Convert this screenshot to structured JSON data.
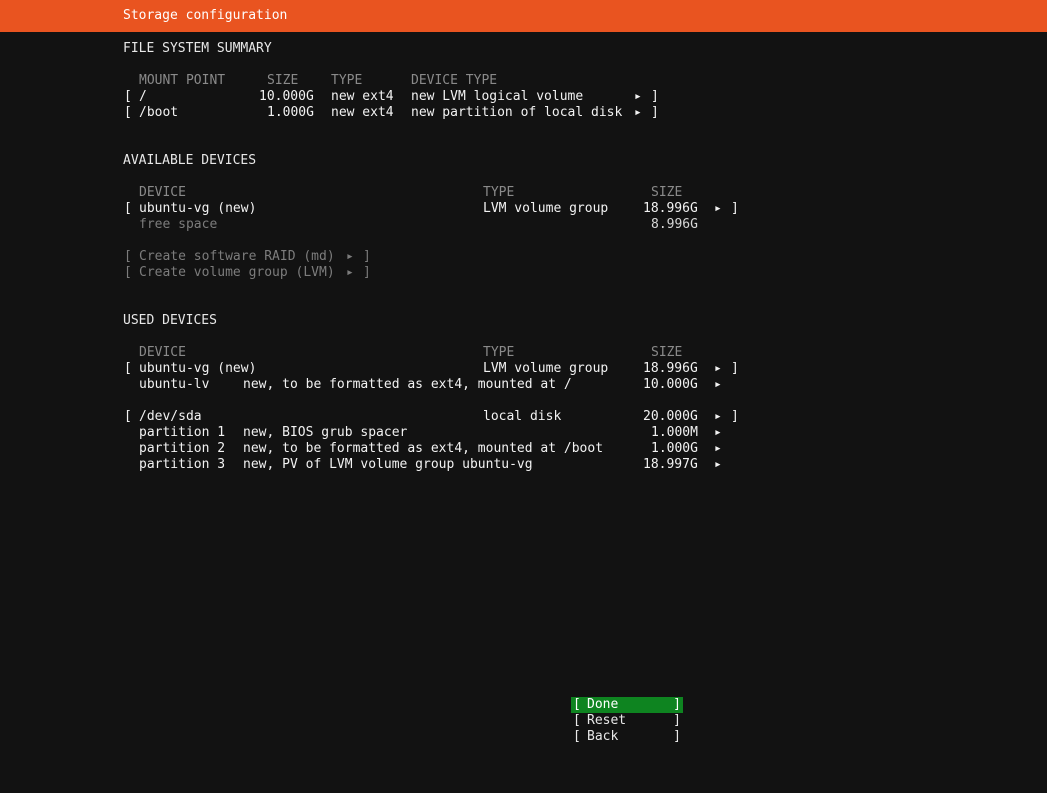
{
  "header": {
    "title": "Storage configuration"
  },
  "fs_summary": {
    "title": "FILE SYSTEM SUMMARY",
    "columns": {
      "mount": "MOUNT POINT",
      "size": "SIZE",
      "type": "TYPE",
      "device_type": "DEVICE TYPE"
    },
    "rows": [
      {
        "mount": "/",
        "size": "10.000G",
        "type": "new ext4",
        "device_type": "new LVM logical volume"
      },
      {
        "mount": "/boot",
        "size": "1.000G",
        "type": "new ext4",
        "device_type": "new partition of local disk"
      }
    ]
  },
  "available": {
    "title": "AVAILABLE DEVICES",
    "columns": {
      "device": "DEVICE",
      "type": "TYPE",
      "size": "SIZE"
    },
    "vg": {
      "device": "ubuntu-vg (new)",
      "type": "LVM volume group",
      "size": "18.996G"
    },
    "free": {
      "label": "free space",
      "size": "8.996G"
    },
    "actions": {
      "raid": "Create software RAID (md)",
      "lvm": "Create volume group (LVM)"
    }
  },
  "used": {
    "title": "USED DEVICES",
    "columns": {
      "device": "DEVICE",
      "type": "TYPE",
      "size": "SIZE"
    },
    "vg": {
      "device": "ubuntu-vg (new)",
      "type": "LVM volume group",
      "size": "18.996G"
    },
    "lv": {
      "name": "ubuntu-lv",
      "desc": "new, to be formatted as ext4, mounted at /",
      "size": "10.000G"
    },
    "disk": {
      "device": "/dev/sda",
      "type": "local disk",
      "size": "20.000G"
    },
    "partitions": [
      {
        "name": "partition 1",
        "desc": "new, BIOS grub spacer",
        "size": "1.000M"
      },
      {
        "name": "partition 2",
        "desc": "new, to be formatted as ext4, mounted at /boot",
        "size": "1.000G"
      },
      {
        "name": "partition 3",
        "desc": "new, PV of LVM volume group ubuntu-vg",
        "size": "18.997G"
      }
    ]
  },
  "buttons": {
    "done": "Done",
    "reset": "Reset",
    "back": "Back"
  },
  "symbols": {
    "lbr": "[",
    "rbr": "]",
    "arrow": "▸"
  },
  "colors": {
    "title_bar": "#e95420",
    "focus": "#0e8420",
    "background": "#121212"
  }
}
